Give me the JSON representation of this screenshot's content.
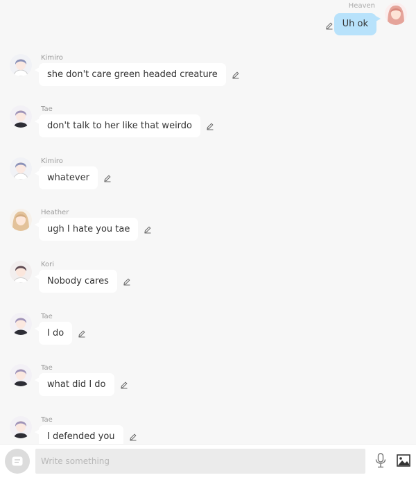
{
  "outgoing": {
    "name": "Heaven",
    "text": "Uh ok",
    "avatar": "avatar-pink-hair",
    "accent": "#b8e2fb"
  },
  "messages": [
    {
      "name": "Kimiro",
      "text": "she don't care green headed creature",
      "avatar": "avatar-blue-hair"
    },
    {
      "name": "Tae",
      "text": "don't talk to her like that weirdo",
      "avatar": "avatar-purple-hair"
    },
    {
      "name": "Kimiro",
      "text": "whatever",
      "avatar": "avatar-blue-hair"
    },
    {
      "name": "Heather",
      "text": "ugh I hate you tae",
      "avatar": "avatar-blonde-hair"
    },
    {
      "name": "Kori",
      "text": "Nobody cares",
      "avatar": "avatar-brown-hair"
    },
    {
      "name": "Tae",
      "text": "I do",
      "avatar": "avatar-purple-hair"
    },
    {
      "name": "Tae",
      "text": "what did I do",
      "avatar": "avatar-purple-hair"
    },
    {
      "name": "Tae",
      "text": "I defended you",
      "avatar": "avatar-purple-hair"
    }
  ],
  "composer": {
    "placeholder": "Write something",
    "menu_icon": "chat-menu-icon",
    "mic_icon": "microphone-icon",
    "image_icon": "image-icon"
  },
  "colors": {
    "background": "#f7f7f7",
    "bubble_in": "#ffffff",
    "bubble_out": "#b8e2fb"
  }
}
